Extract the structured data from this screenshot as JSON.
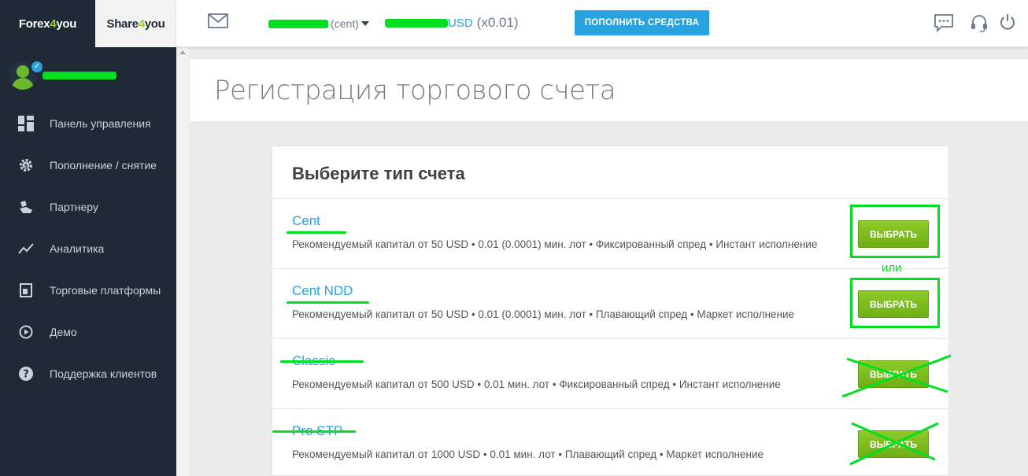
{
  "brand": {
    "forex_prefix": "Forex",
    "forex_accent": "4",
    "forex_suffix": "you",
    "share_prefix": "Share",
    "share_accent": "4",
    "share_suffix": "you"
  },
  "sidebar": {
    "items": [
      {
        "label": "Панель управления",
        "icon": "dashboard-icon"
      },
      {
        "label": "Пополнение / снятие",
        "icon": "gear-dollar-icon"
      },
      {
        "label": "Партнеру",
        "icon": "partner-icon"
      },
      {
        "label": "Аналитика",
        "icon": "trend-icon"
      },
      {
        "label": "Торговые платформы",
        "icon": "platform-icon"
      },
      {
        "label": "Демо",
        "icon": "play-icon"
      },
      {
        "label": "Поддержка клиентов",
        "icon": "help-icon"
      }
    ]
  },
  "topbar": {
    "account_type": "(cent)",
    "balance_currency": "USD",
    "balance_multiplier": "(x0.01)",
    "deposit_label": "ПОПОЛНИТЬ СРЕДСТВА"
  },
  "page": {
    "title": "Регистрация торгового счета"
  },
  "panel": {
    "title": "Выберите тип счета",
    "choose_label": "ВЫБРАТЬ",
    "accounts": [
      {
        "name": "Cent",
        "desc": "Рекомендуемый капитал от 50 USD • 0.01 (0.0001) мин. лот • Фиксированный спред • Инстант исполнение"
      },
      {
        "name": "Cent NDD",
        "desc": "Рекомендуемый капитал от 50 USD • 0.01 (0.0001) мин. лот • Плавающий спред • Маркет исполнение"
      },
      {
        "name": "Classic",
        "desc": "Рекомендуемый капитал от 500 USD • 0.01 мин. лот • Фиксированный спред • Инстант исполнение"
      },
      {
        "name": "Pro STP",
        "desc": "Рекомендуемый капитал от 1000 USD • 0.01 мин. лот • Плавающий спред • Маркет исполнение"
      }
    ]
  },
  "annotation": {
    "or_text": "или"
  },
  "colors": {
    "sidebar": "#1f2a36",
    "accent_blue": "#29a3dd",
    "button_green": "#7dbb1f",
    "markup_green": "#00e020"
  }
}
